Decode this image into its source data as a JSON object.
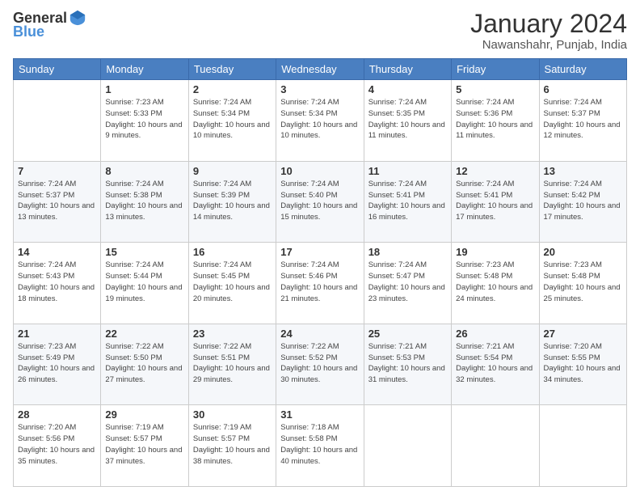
{
  "header": {
    "logo": {
      "general": "General",
      "blue": "Blue"
    },
    "title": "January 2024",
    "location": "Nawanshahr, Punjab, India"
  },
  "days_of_week": [
    "Sunday",
    "Monday",
    "Tuesday",
    "Wednesday",
    "Thursday",
    "Friday",
    "Saturday"
  ],
  "weeks": [
    [
      {
        "day": "",
        "sunrise": "",
        "sunset": "",
        "daylight": ""
      },
      {
        "day": "1",
        "sunrise": "Sunrise: 7:23 AM",
        "sunset": "Sunset: 5:33 PM",
        "daylight": "Daylight: 10 hours and 9 minutes."
      },
      {
        "day": "2",
        "sunrise": "Sunrise: 7:24 AM",
        "sunset": "Sunset: 5:34 PM",
        "daylight": "Daylight: 10 hours and 10 minutes."
      },
      {
        "day": "3",
        "sunrise": "Sunrise: 7:24 AM",
        "sunset": "Sunset: 5:34 PM",
        "daylight": "Daylight: 10 hours and 10 minutes."
      },
      {
        "day": "4",
        "sunrise": "Sunrise: 7:24 AM",
        "sunset": "Sunset: 5:35 PM",
        "daylight": "Daylight: 10 hours and 11 minutes."
      },
      {
        "day": "5",
        "sunrise": "Sunrise: 7:24 AM",
        "sunset": "Sunset: 5:36 PM",
        "daylight": "Daylight: 10 hours and 11 minutes."
      },
      {
        "day": "6",
        "sunrise": "Sunrise: 7:24 AM",
        "sunset": "Sunset: 5:37 PM",
        "daylight": "Daylight: 10 hours and 12 minutes."
      }
    ],
    [
      {
        "day": "7",
        "sunrise": "Sunrise: 7:24 AM",
        "sunset": "Sunset: 5:37 PM",
        "daylight": "Daylight: 10 hours and 13 minutes."
      },
      {
        "day": "8",
        "sunrise": "Sunrise: 7:24 AM",
        "sunset": "Sunset: 5:38 PM",
        "daylight": "Daylight: 10 hours and 13 minutes."
      },
      {
        "day": "9",
        "sunrise": "Sunrise: 7:24 AM",
        "sunset": "Sunset: 5:39 PM",
        "daylight": "Daylight: 10 hours and 14 minutes."
      },
      {
        "day": "10",
        "sunrise": "Sunrise: 7:24 AM",
        "sunset": "Sunset: 5:40 PM",
        "daylight": "Daylight: 10 hours and 15 minutes."
      },
      {
        "day": "11",
        "sunrise": "Sunrise: 7:24 AM",
        "sunset": "Sunset: 5:41 PM",
        "daylight": "Daylight: 10 hours and 16 minutes."
      },
      {
        "day": "12",
        "sunrise": "Sunrise: 7:24 AM",
        "sunset": "Sunset: 5:41 PM",
        "daylight": "Daylight: 10 hours and 17 minutes."
      },
      {
        "day": "13",
        "sunrise": "Sunrise: 7:24 AM",
        "sunset": "Sunset: 5:42 PM",
        "daylight": "Daylight: 10 hours and 17 minutes."
      }
    ],
    [
      {
        "day": "14",
        "sunrise": "Sunrise: 7:24 AM",
        "sunset": "Sunset: 5:43 PM",
        "daylight": "Daylight: 10 hours and 18 minutes."
      },
      {
        "day": "15",
        "sunrise": "Sunrise: 7:24 AM",
        "sunset": "Sunset: 5:44 PM",
        "daylight": "Daylight: 10 hours and 19 minutes."
      },
      {
        "day": "16",
        "sunrise": "Sunrise: 7:24 AM",
        "sunset": "Sunset: 5:45 PM",
        "daylight": "Daylight: 10 hours and 20 minutes."
      },
      {
        "day": "17",
        "sunrise": "Sunrise: 7:24 AM",
        "sunset": "Sunset: 5:46 PM",
        "daylight": "Daylight: 10 hours and 21 minutes."
      },
      {
        "day": "18",
        "sunrise": "Sunrise: 7:24 AM",
        "sunset": "Sunset: 5:47 PM",
        "daylight": "Daylight: 10 hours and 23 minutes."
      },
      {
        "day": "19",
        "sunrise": "Sunrise: 7:23 AM",
        "sunset": "Sunset: 5:48 PM",
        "daylight": "Daylight: 10 hours and 24 minutes."
      },
      {
        "day": "20",
        "sunrise": "Sunrise: 7:23 AM",
        "sunset": "Sunset: 5:48 PM",
        "daylight": "Daylight: 10 hours and 25 minutes."
      }
    ],
    [
      {
        "day": "21",
        "sunrise": "Sunrise: 7:23 AM",
        "sunset": "Sunset: 5:49 PM",
        "daylight": "Daylight: 10 hours and 26 minutes."
      },
      {
        "day": "22",
        "sunrise": "Sunrise: 7:22 AM",
        "sunset": "Sunset: 5:50 PM",
        "daylight": "Daylight: 10 hours and 27 minutes."
      },
      {
        "day": "23",
        "sunrise": "Sunrise: 7:22 AM",
        "sunset": "Sunset: 5:51 PM",
        "daylight": "Daylight: 10 hours and 29 minutes."
      },
      {
        "day": "24",
        "sunrise": "Sunrise: 7:22 AM",
        "sunset": "Sunset: 5:52 PM",
        "daylight": "Daylight: 10 hours and 30 minutes."
      },
      {
        "day": "25",
        "sunrise": "Sunrise: 7:21 AM",
        "sunset": "Sunset: 5:53 PM",
        "daylight": "Daylight: 10 hours and 31 minutes."
      },
      {
        "day": "26",
        "sunrise": "Sunrise: 7:21 AM",
        "sunset": "Sunset: 5:54 PM",
        "daylight": "Daylight: 10 hours and 32 minutes."
      },
      {
        "day": "27",
        "sunrise": "Sunrise: 7:20 AM",
        "sunset": "Sunset: 5:55 PM",
        "daylight": "Daylight: 10 hours and 34 minutes."
      }
    ],
    [
      {
        "day": "28",
        "sunrise": "Sunrise: 7:20 AM",
        "sunset": "Sunset: 5:56 PM",
        "daylight": "Daylight: 10 hours and 35 minutes."
      },
      {
        "day": "29",
        "sunrise": "Sunrise: 7:19 AM",
        "sunset": "Sunset: 5:57 PM",
        "daylight": "Daylight: 10 hours and 37 minutes."
      },
      {
        "day": "30",
        "sunrise": "Sunrise: 7:19 AM",
        "sunset": "Sunset: 5:57 PM",
        "daylight": "Daylight: 10 hours and 38 minutes."
      },
      {
        "day": "31",
        "sunrise": "Sunrise: 7:18 AM",
        "sunset": "Sunset: 5:58 PM",
        "daylight": "Daylight: 10 hours and 40 minutes."
      },
      {
        "day": "",
        "sunrise": "",
        "sunset": "",
        "daylight": ""
      },
      {
        "day": "",
        "sunrise": "",
        "sunset": "",
        "daylight": ""
      },
      {
        "day": "",
        "sunrise": "",
        "sunset": "",
        "daylight": ""
      }
    ]
  ]
}
